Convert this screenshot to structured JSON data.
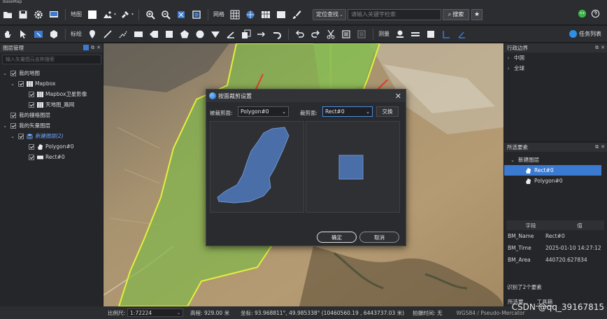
{
  "title_strip": "BaseMap",
  "toolbar1": {
    "map_label": "地图",
    "grid_label": "网格",
    "locate_select": "定位查找",
    "search_placeholder": "请输入关键字检索",
    "search_button": "搜索"
  },
  "toolbar2": {
    "draw_label": "标绘",
    "measure_label": "测量",
    "task_list": "任务列表"
  },
  "left_panel": {
    "title": "图层管理",
    "filter_placeholder": "输入矢量图元名称搜索",
    "tree": {
      "my_map": "我的地图",
      "mapbox": "Mapbox",
      "mapbox_satellite": "Mapbox卫星影像",
      "tianditu_road": "天地图_路网",
      "my_raster": "我的栅格图层",
      "my_vector": "我的矢量图层",
      "new_layer": "新建图层(2)",
      "polygon": "Polygon#0",
      "rect": "Rect#0"
    }
  },
  "right_top": {
    "title": "行政边界",
    "items": [
      "中国",
      "全球"
    ]
  },
  "right_bottom": {
    "title": "所选要素",
    "layer": "新建图层",
    "features": [
      "Rect#0",
      "Polygon#0"
    ],
    "table_headers": [
      "字段",
      "值"
    ],
    "rows": [
      {
        "k": "BM_Name",
        "v": "Rect#0"
      },
      {
        "k": "BM_Time",
        "v": "2025-01-10 14:27:12"
      },
      {
        "k": "BM_Area",
        "v": "440720.627834"
      }
    ],
    "identified": "识别了2个要素",
    "tabs": [
      "所选要...",
      "工具箱"
    ]
  },
  "dialog": {
    "title": "按面裁剪设置",
    "clipped_label": "被裁剪面:",
    "clipped_value": "Polygon#0",
    "clipper_label": "裁剪面:",
    "clipper_value": "Rect#0",
    "swap": "交换",
    "ok": "确定",
    "cancel": "取消"
  },
  "statusbar": {
    "scale_label": "比例尺:",
    "scale_value": "1:72224",
    "elevation": "高程: 929.00 米",
    "coords": "坐标: 93.968811°, 49.985338°  (10460560.19 , 6443737.03 米)",
    "shot_time": "拍摄时间: 无",
    "overlay": "WGS84 / Pseudo-Mercator"
  },
  "watermark": "CSDN @qq_39167815",
  "colors": {
    "accent": "#3a7ad0",
    "polygon_fill": "#4a6ea8",
    "map_green": "#7fb84a",
    "arrow": "#e23b2e"
  }
}
